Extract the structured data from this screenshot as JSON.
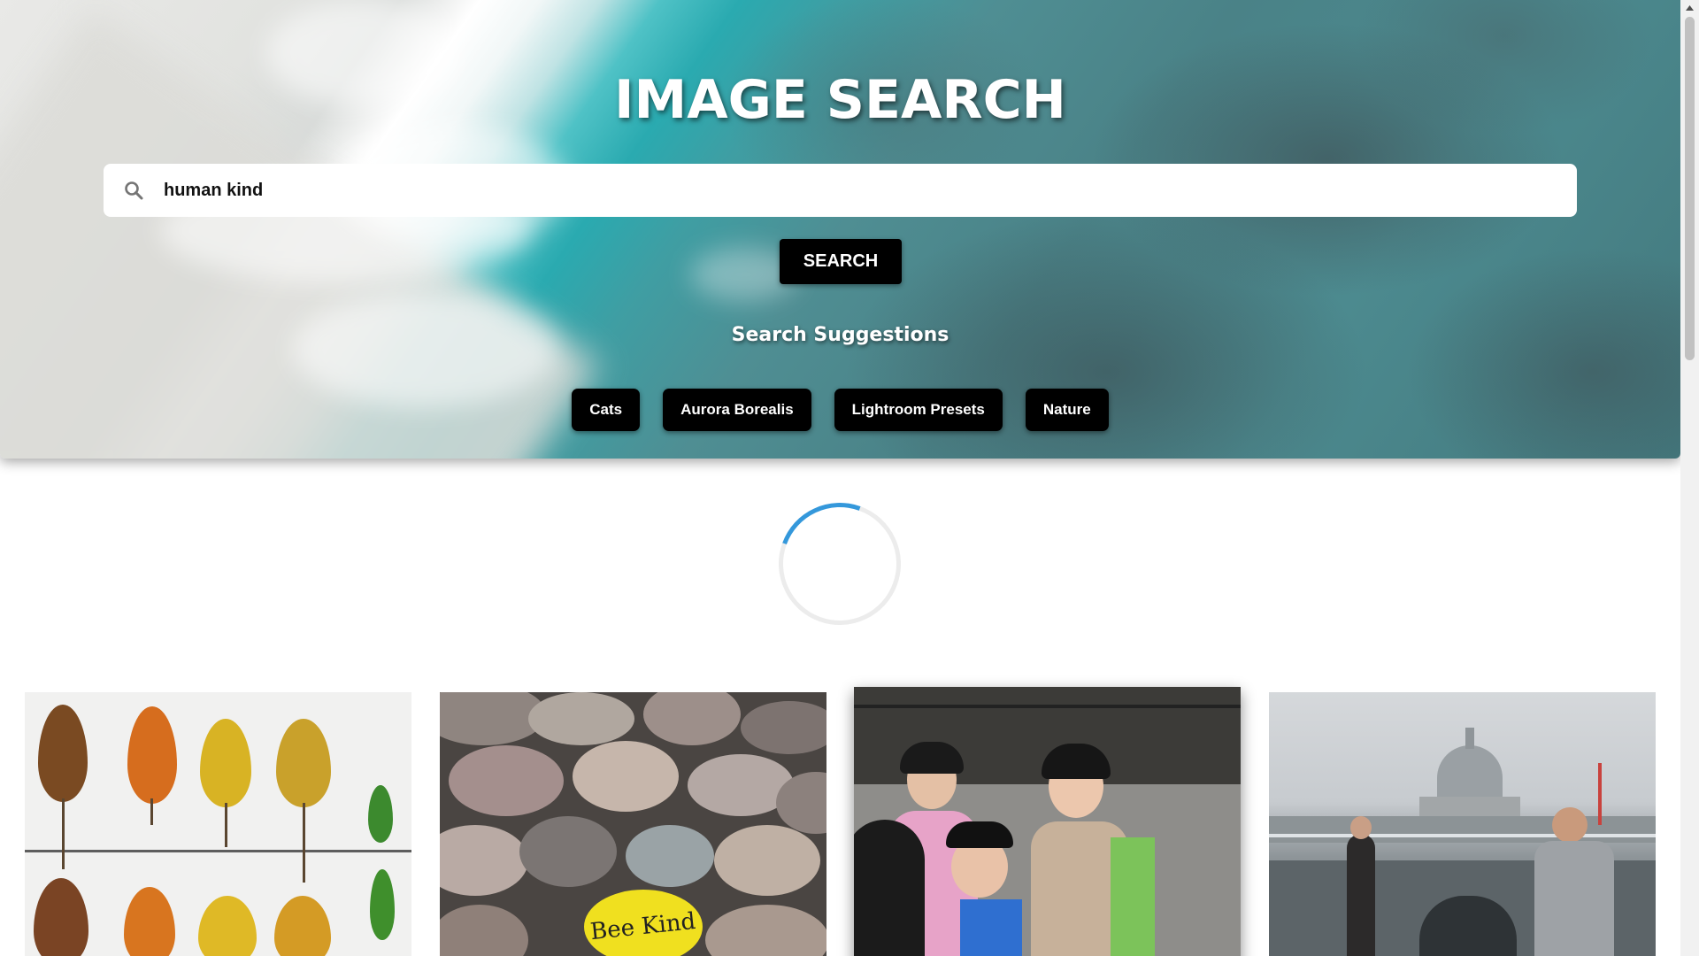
{
  "header": {
    "title": "IMAGE SEARCH"
  },
  "search": {
    "value": "human kind",
    "placeholder": "",
    "icon": "search-icon",
    "button_label": "SEARCH"
  },
  "suggestions": {
    "title": "Search Suggestions",
    "items": [
      "Cats",
      "Aurora Borealis",
      "Lightroom Presets",
      "Nature"
    ]
  },
  "loader": {
    "icon": "spinner-icon"
  },
  "results": {
    "images": [
      {
        "subject": "autumn-leaves-photo"
      },
      {
        "subject": "bee-kind-pebbles-photo",
        "text": "Bee Kind"
      },
      {
        "subject": "people-smiling-photo"
      },
      {
        "subject": "london-millennium-bridge-photo"
      }
    ]
  },
  "colors": {
    "button_bg": "#000000",
    "button_text": "#ffffff",
    "spinner_accent": "#3498db",
    "spinner_track": "#ececec"
  }
}
